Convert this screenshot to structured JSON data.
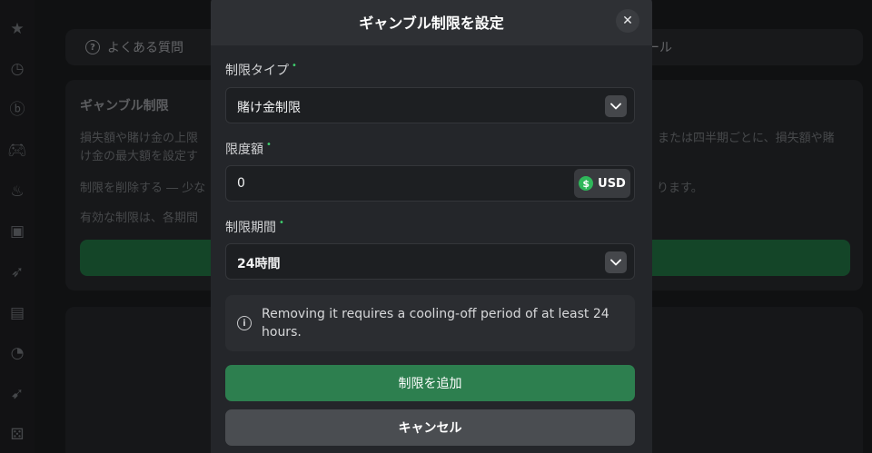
{
  "background": {
    "topbar": {
      "faq_label": "よくある質問",
      "tab_tail": "ール"
    },
    "card": {
      "title": "ギャンブル制限",
      "line1_left": "損失額や賭け金の上限",
      "line1_right": "または四半期ごとに、損失額や賭",
      "line2_left": "け金の最大額を設定す",
      "line3_left": "制限を削除する ― 少な",
      "line3_right": "ります。",
      "line4_left": "有効な制限は、各期間"
    }
  },
  "sidebar": {
    "icons": [
      "star-icon",
      "clock-icon",
      "bitcoin-icon",
      "gamepad-icon",
      "flame-icon",
      "ticket-icon",
      "rocket-icon",
      "calendar-star-icon",
      "pacman-icon",
      "rocket-alt-icon",
      "dice-icon"
    ]
  },
  "modal": {
    "title": "ギャンブル制限を設定",
    "close_glyph": "✕",
    "limit_type": {
      "label": "制限タイプ",
      "required": "•",
      "value": "賭け金制限"
    },
    "limit_amount": {
      "label": "限度額",
      "required": "•",
      "value": "0",
      "currency": "USD",
      "currency_symbol": "$"
    },
    "limit_period": {
      "label": "制限期間",
      "required": "•",
      "value": "24時間"
    },
    "notice": {
      "text": "Removing it requires a cooling-off period of at least 24 hours."
    },
    "primary_button": "制限を追加",
    "secondary_button": "キャンセル"
  },
  "colors": {
    "accent_green": "#2d7f4f",
    "required_green": "#3fcf6e",
    "modal_bg": "#24262a"
  }
}
